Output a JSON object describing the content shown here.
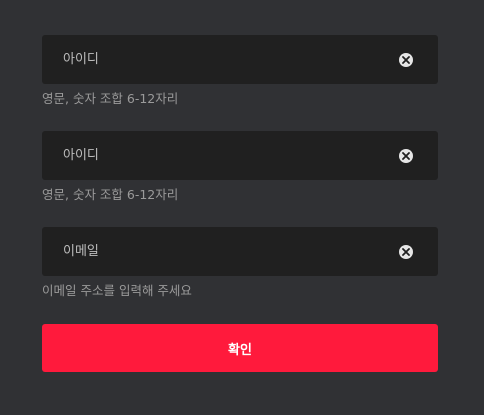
{
  "form": {
    "fields": [
      {
        "placeholder": "아이디",
        "value": "",
        "hint": "영문, 숫자 조합 6-12자리",
        "clear_icon": "close-circle-icon"
      },
      {
        "placeholder": "아이디",
        "value": "",
        "hint": "영문, 숫자 조합 6-12자리",
        "clear_icon": "close-circle-icon"
      },
      {
        "placeholder": "이메일",
        "value": "",
        "hint": "이메일 주소를 입력해 주세요",
        "clear_icon": "close-circle-icon"
      }
    ],
    "submit_label": "확인"
  },
  "colors": {
    "background": "#303134",
    "field_background": "#202020",
    "accent": "#ff1a3c",
    "hint_text": "#9a9a9a"
  }
}
